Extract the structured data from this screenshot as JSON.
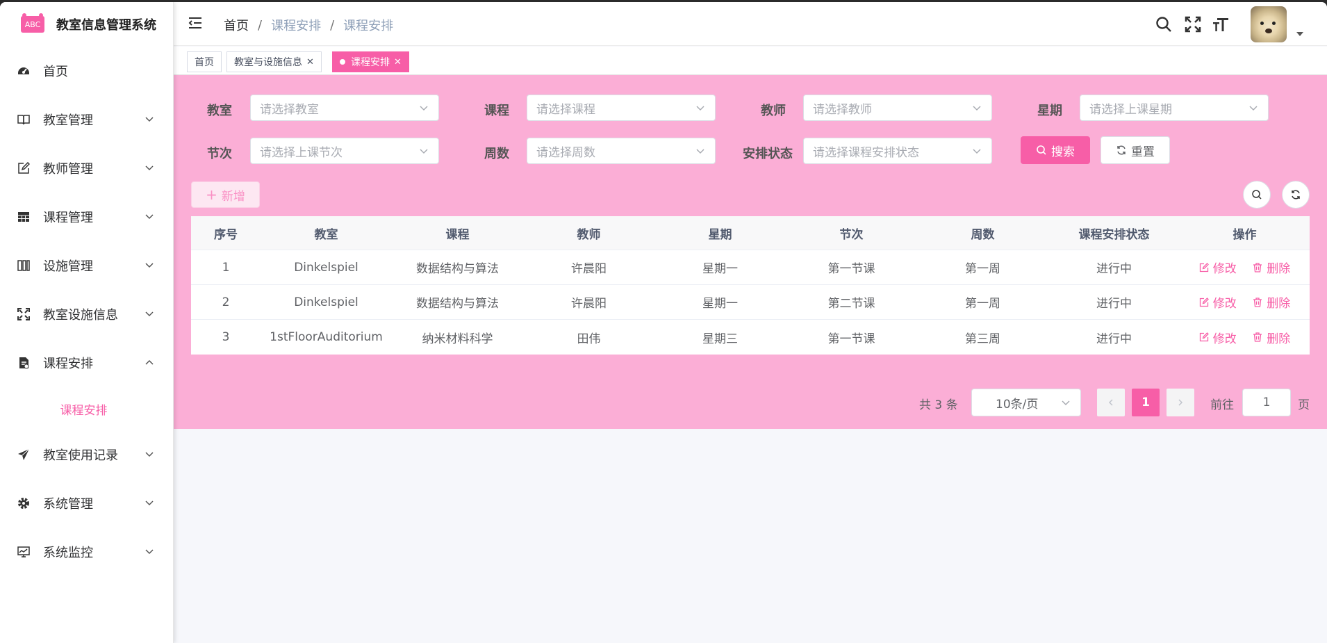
{
  "app": {
    "logo_text": "ABC",
    "title": "教室信息管理系统"
  },
  "sidebar": {
    "items": [
      {
        "label": "首页",
        "icon": "dashboard-icon"
      },
      {
        "label": "教室管理",
        "icon": "book-icon"
      },
      {
        "label": "教师管理",
        "icon": "edit-icon"
      },
      {
        "label": "课程管理",
        "icon": "grid-icon"
      },
      {
        "label": "设施管理",
        "icon": "columns-icon"
      },
      {
        "label": "教室设施信息",
        "icon": "fullscreen-icon"
      },
      {
        "label": "课程安排",
        "icon": "document-icon",
        "expanded": true
      },
      {
        "label": "教室使用记录",
        "icon": "send-icon"
      },
      {
        "label": "系统管理",
        "icon": "gear-icon"
      },
      {
        "label": "系统监控",
        "icon": "monitor-icon"
      }
    ],
    "submenu_active": "课程安排"
  },
  "header": {
    "breadcrumb": [
      "首页",
      "课程安排",
      "课程安排"
    ],
    "icons": [
      "search-icon",
      "fullscreen-icon",
      "font-size-icon"
    ]
  },
  "tags": [
    {
      "label": "首页"
    },
    {
      "label": "教室与设施信息",
      "closable": true
    },
    {
      "label": "课程安排",
      "closable": true,
      "active": true
    }
  ],
  "filters": {
    "classroom": {
      "label": "教室",
      "placeholder": "请选择教室"
    },
    "course": {
      "label": "课程",
      "placeholder": "请选择课程"
    },
    "teacher": {
      "label": "教师",
      "placeholder": "请选择教师"
    },
    "weekday": {
      "label": "星期",
      "placeholder": "请选择上课星期"
    },
    "period": {
      "label": "节次",
      "placeholder": "请选择上课节次"
    },
    "week": {
      "label": "周数",
      "placeholder": "请选择周数"
    },
    "status": {
      "label": "安排状态",
      "placeholder": "请选择课程安排状态"
    },
    "search_button": "搜索",
    "reset_button": "重置"
  },
  "toolbar": {
    "add_button": "新增"
  },
  "table": {
    "columns": [
      "序号",
      "教室",
      "课程",
      "教师",
      "星期",
      "节次",
      "周数",
      "课程安排状态",
      "操作"
    ],
    "rows": [
      [
        "1",
        "Dinkelspiel",
        "数据结构与算法",
        "许晨阳",
        "星期一",
        "第一节课",
        "第一周",
        "进行中"
      ],
      [
        "2",
        "Dinkelspiel",
        "数据结构与算法",
        "许晨阳",
        "星期一",
        "第二节课",
        "第一周",
        "进行中"
      ],
      [
        "3",
        "1stFloorAuditorium",
        "纳米材料科学",
        "田伟",
        "星期三",
        "第一节课",
        "第三周",
        "进行中"
      ]
    ],
    "edit_label": "修改",
    "delete_label": "删除"
  },
  "pagination": {
    "total_text": "共 3 条",
    "page_size": "10条/页",
    "current_page": "1",
    "goto_label": "前往",
    "goto_value": "1",
    "page_suffix": "页"
  },
  "colors": {
    "accent": "#f75ea7",
    "pink_bg": "#fbaed6"
  }
}
